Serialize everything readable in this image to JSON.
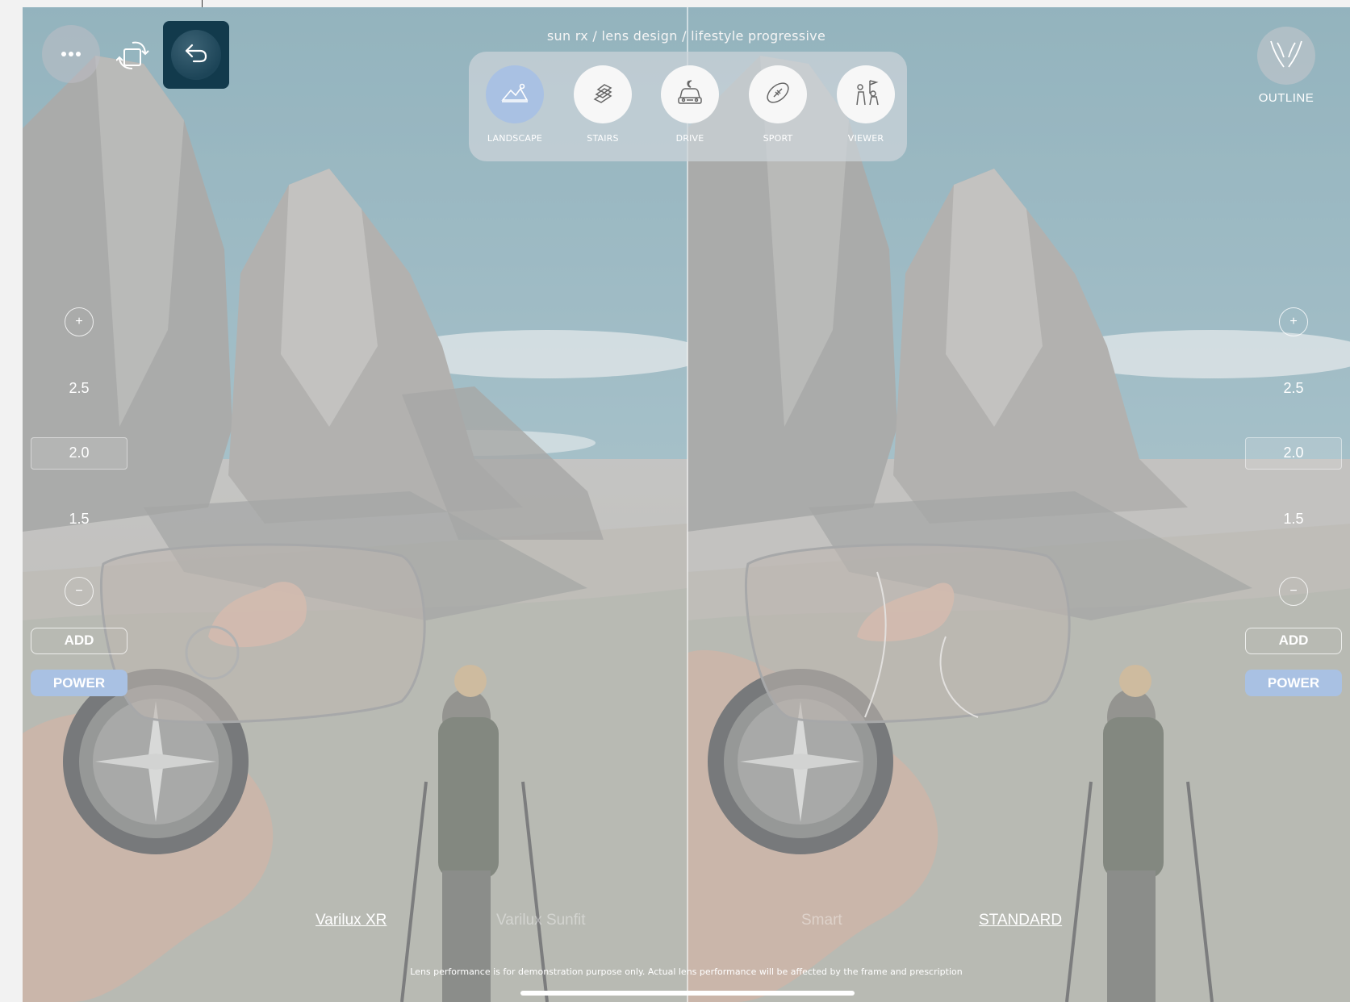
{
  "breadcrumb": "sun rx / lens design / lifestyle progressive",
  "toolbar": {
    "more_icon": "ellipsis-icon",
    "rotate_icon": "rotate-screen-icon",
    "back_icon": "undo-arrow-icon"
  },
  "scenarios": [
    {
      "label": "LANDSCAPE",
      "icon": "landscape-icon",
      "active": true
    },
    {
      "label": "STAIRS",
      "icon": "stairs-icon",
      "active": false
    },
    {
      "label": "DRIVE",
      "icon": "car-night-icon",
      "active": false
    },
    {
      "label": "SPORT",
      "icon": "football-icon",
      "active": false
    },
    {
      "label": "VIEWER",
      "icon": "hikers-flag-icon",
      "active": false
    }
  ],
  "outline": {
    "label": "OUTLINE",
    "icon": "lens-outline-icon"
  },
  "left_panel": {
    "plus": "+",
    "values": [
      "2.5",
      "2.0",
      "1.5"
    ],
    "selected": "2.0",
    "minus": "−",
    "add_label": "ADD",
    "power_label": "POWER"
  },
  "right_panel": {
    "plus": "+",
    "values": [
      "2.5",
      "2.0",
      "1.5"
    ],
    "selected": "2.0",
    "minus": "−",
    "add_label": "ADD",
    "power_label": "POWER"
  },
  "lenses": {
    "left_selected": "Varilux XR",
    "left_other": "Varilux Sunfit",
    "right_other": "Smart",
    "right_selected": "STANDARD"
  },
  "disclaimer": "Lens performance is for demonstration purpose only. Actual lens performance will be affected by the frame and prescription",
  "colors": {
    "accent_blue": "#a9c1e3",
    "back_button": "#123a4c"
  }
}
